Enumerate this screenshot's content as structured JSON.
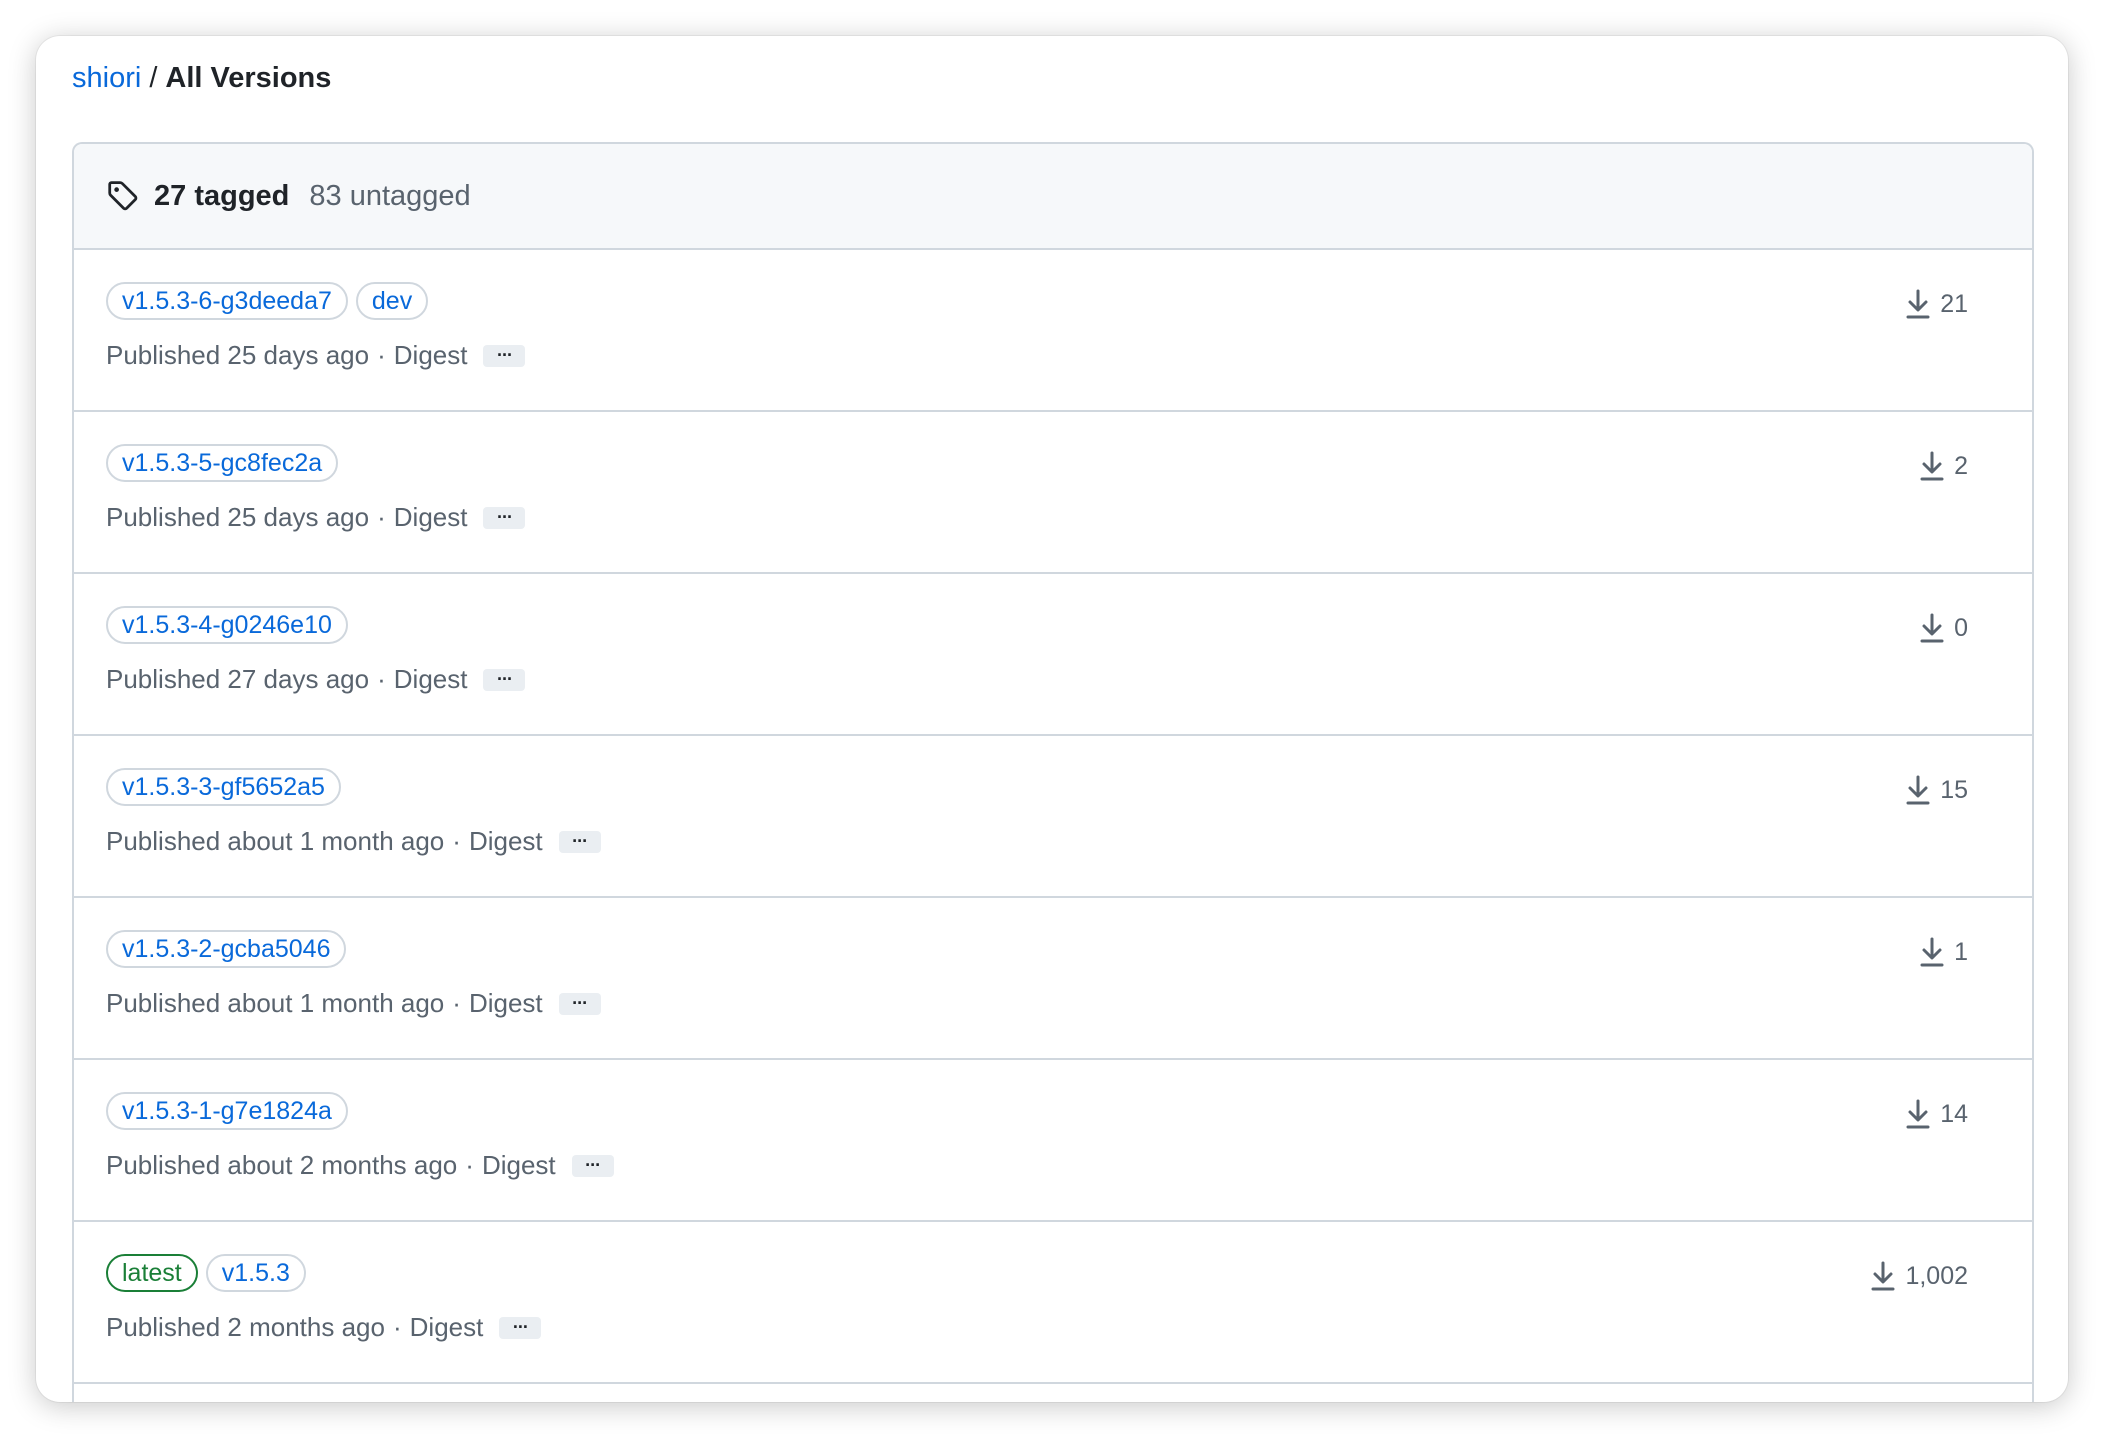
{
  "breadcrumb": {
    "owner": "shiori",
    "separator": "/",
    "current": "All Versions"
  },
  "summary": {
    "tag_icon": "tag-icon",
    "tagged": "27 tagged",
    "untagged": "83 untagged"
  },
  "versions": [
    {
      "tags": [
        {
          "label": "v1.5.3-6-g3deeda7",
          "kind": "default"
        },
        {
          "label": "dev",
          "kind": "default"
        }
      ],
      "published": "Published 25 days ago",
      "digest": "Digest",
      "downloads": "21"
    },
    {
      "tags": [
        {
          "label": "v1.5.3-5-gc8fec2a",
          "kind": "default"
        }
      ],
      "published": "Published 25 days ago",
      "digest": "Digest",
      "downloads": "2"
    },
    {
      "tags": [
        {
          "label": "v1.5.3-4-g0246e10",
          "kind": "default"
        }
      ],
      "published": "Published 27 days ago",
      "digest": "Digest",
      "downloads": "0"
    },
    {
      "tags": [
        {
          "label": "v1.5.3-3-gf5652a5",
          "kind": "default"
        }
      ],
      "published": "Published about 1 month ago",
      "digest": "Digest",
      "downloads": "15"
    },
    {
      "tags": [
        {
          "label": "v1.5.3-2-gcba5046",
          "kind": "default"
        }
      ],
      "published": "Published about 1 month ago",
      "digest": "Digest",
      "downloads": "1"
    },
    {
      "tags": [
        {
          "label": "v1.5.3-1-g7e1824a",
          "kind": "default"
        }
      ],
      "published": "Published about 2 months ago",
      "digest": "Digest",
      "downloads": "14"
    },
    {
      "tags": [
        {
          "label": "latest",
          "kind": "latest"
        },
        {
          "label": "v1.5.3",
          "kind": "default"
        }
      ],
      "published": "Published 2 months ago",
      "digest": "Digest",
      "downloads": "1,002"
    }
  ],
  "ellipsis_label": "···",
  "download_icon": "download-icon",
  "colors": {
    "link": "#0969da",
    "latest": "#1a7f37",
    "muted": "#59636e",
    "border": "#d0d7de",
    "header_bg": "#f6f8fa"
  }
}
